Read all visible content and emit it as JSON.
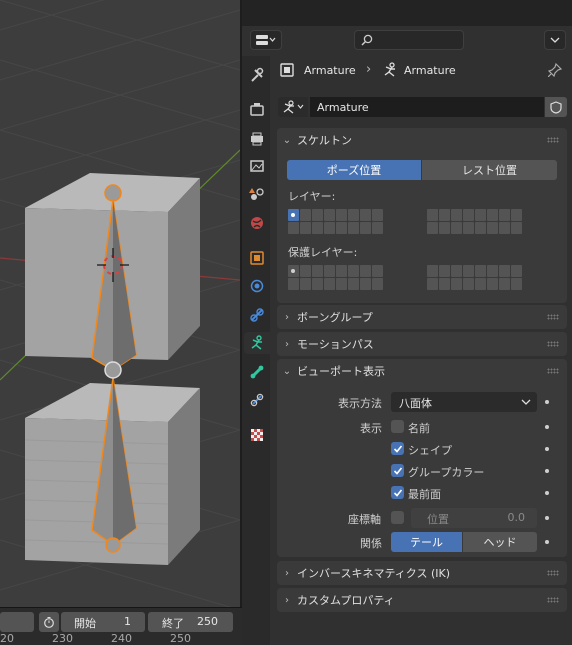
{
  "timeline": {
    "start_label": "開始",
    "start_value": "1",
    "end_label": "終了",
    "end_value": "250",
    "frame_numbers": [
      "20",
      "230",
      "240",
      "250"
    ]
  },
  "header": {
    "breadcrumb_object": "Armature",
    "breadcrumb_data": "Armature",
    "datablock_name": "Armature"
  },
  "panels": {
    "skeleton": {
      "title": "スケルトン",
      "pose_position": "ポーズ位置",
      "rest_position": "レスト位置",
      "layers_label": "レイヤー:",
      "protected_layers_label": "保護レイヤー:"
    },
    "bone_groups": {
      "title": "ボーングループ"
    },
    "motion_paths": {
      "title": "モーションパス"
    },
    "viewport_display": {
      "title": "ビューポート表示",
      "display_as_label": "表示方法",
      "display_as_value": "八面体",
      "show_label": "表示",
      "names": {
        "label": "名前",
        "checked": false
      },
      "shapes": {
        "label": "シェイプ",
        "checked": true
      },
      "group_colors": {
        "label": "グループカラー",
        "checked": true
      },
      "in_front": {
        "label": "最前面",
        "checked": true
      },
      "axes_label": "座標軸",
      "axes_position_label": "位置",
      "axes_position_value": "0.0",
      "relation_label": "関係",
      "relation_tail": "テール",
      "relation_head": "ヘッド"
    },
    "ik": {
      "title": "インバースキネマティクス (IK)"
    },
    "custom_props": {
      "title": "カスタムプロパティ"
    }
  },
  "colors": {
    "accent": "#4772b3",
    "bone_outline": "#f2871a",
    "panel_bg": "#3a3a3a"
  }
}
